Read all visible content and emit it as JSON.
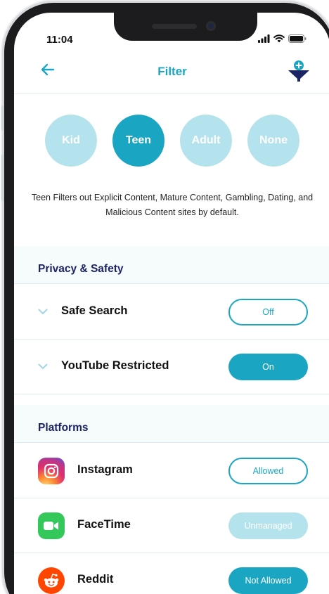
{
  "status_bar": {
    "time": "11:04"
  },
  "nav": {
    "title": "Filter"
  },
  "filter_levels": [
    {
      "label": "Kid",
      "selected": false
    },
    {
      "label": "Teen",
      "selected": true
    },
    {
      "label": "Adult",
      "selected": false
    },
    {
      "label": "None",
      "selected": false
    }
  ],
  "description": "Teen Filters out Explicit Content, Mature Content, Gambling, Dating, and Malicious Content sites by default.",
  "privacy": {
    "title": "Privacy & Safety",
    "items": [
      {
        "label": "Safe Search",
        "value": "Off",
        "state": "off"
      },
      {
        "label": "YouTube Restricted",
        "value": "On",
        "state": "on"
      }
    ]
  },
  "platforms": {
    "title": "Platforms",
    "items": [
      {
        "label": "Instagram",
        "value": "Allowed",
        "state": "allowed",
        "icon": "instagram-icon"
      },
      {
        "label": "FaceTime",
        "value": "Unmanaged",
        "state": "unmanaged",
        "icon": "facetime-icon"
      },
      {
        "label": "Reddit",
        "value": "Not Allowed",
        "state": "not-allowed",
        "icon": "reddit-icon"
      }
    ]
  },
  "colors": {
    "accent": "#1aa6c2",
    "accent_light": "#b5e3ed",
    "navy": "#1c2466"
  }
}
